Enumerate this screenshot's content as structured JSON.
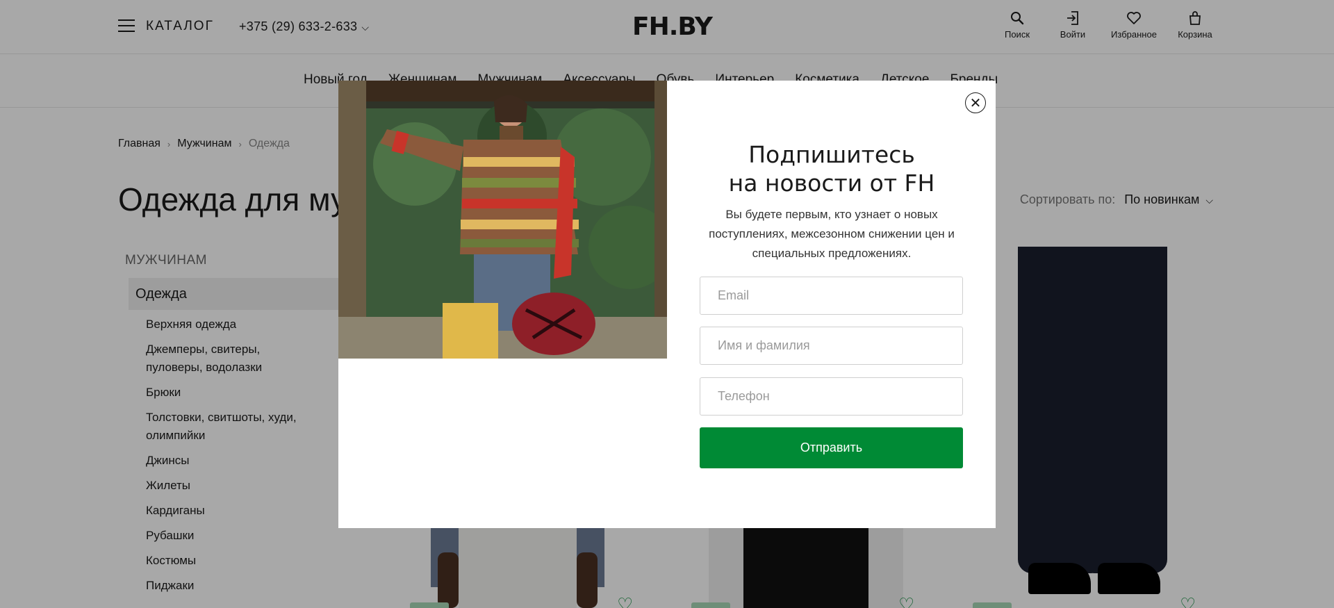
{
  "header": {
    "catalog_label": "КАТАЛОГ",
    "phone": "+375 (29) 633-2-633",
    "logo": "FH.BY",
    "actions": [
      {
        "label": "Поиск",
        "icon": "search-icon"
      },
      {
        "label": "Войти",
        "icon": "login-icon"
      },
      {
        "label": "Избранное",
        "icon": "heart-icon"
      },
      {
        "label": "Корзина",
        "icon": "bag-icon"
      }
    ]
  },
  "nav": {
    "items": [
      "Новый год",
      "Женщинам",
      "Мужчинам",
      "Аксессуары",
      "Обувь",
      "Интерьер",
      "Косметика",
      "Детское",
      "Бренды"
    ]
  },
  "breadcrumb": {
    "items": [
      "Главная",
      "Мужчинам",
      "Одежда"
    ]
  },
  "page": {
    "title": "Одежда для мужчин",
    "sort_label": "Сортировать по:",
    "sort_value": "По новинкам"
  },
  "sidebar": {
    "heading": "МУЖЧИНАМ",
    "active": "Одежда",
    "items": [
      "Верхняя одежда",
      "Джемперы, свитеры, пуловеры, водолазки",
      "Брюки",
      "Толстовки, свитшоты, худи, олимпийки",
      "Джинсы",
      "Жилеты",
      "Кардиганы",
      "Рубашки",
      "Костюмы",
      "Пиджаки"
    ]
  },
  "modal": {
    "title_line1": "Подпишитесь",
    "title_line2": "на новости от FH",
    "description": "Вы будете первым, кто узнает о новых поступлениях, межсезонном снижении цен и специальных предложениях.",
    "email_placeholder": "Email",
    "name_placeholder": "Имя и фамилия",
    "phone_placeholder": "Телефон",
    "submit_label": "Отправить"
  },
  "colors": {
    "accent": "#008a35",
    "overlay": "rgba(0,0,0,0.34)"
  }
}
